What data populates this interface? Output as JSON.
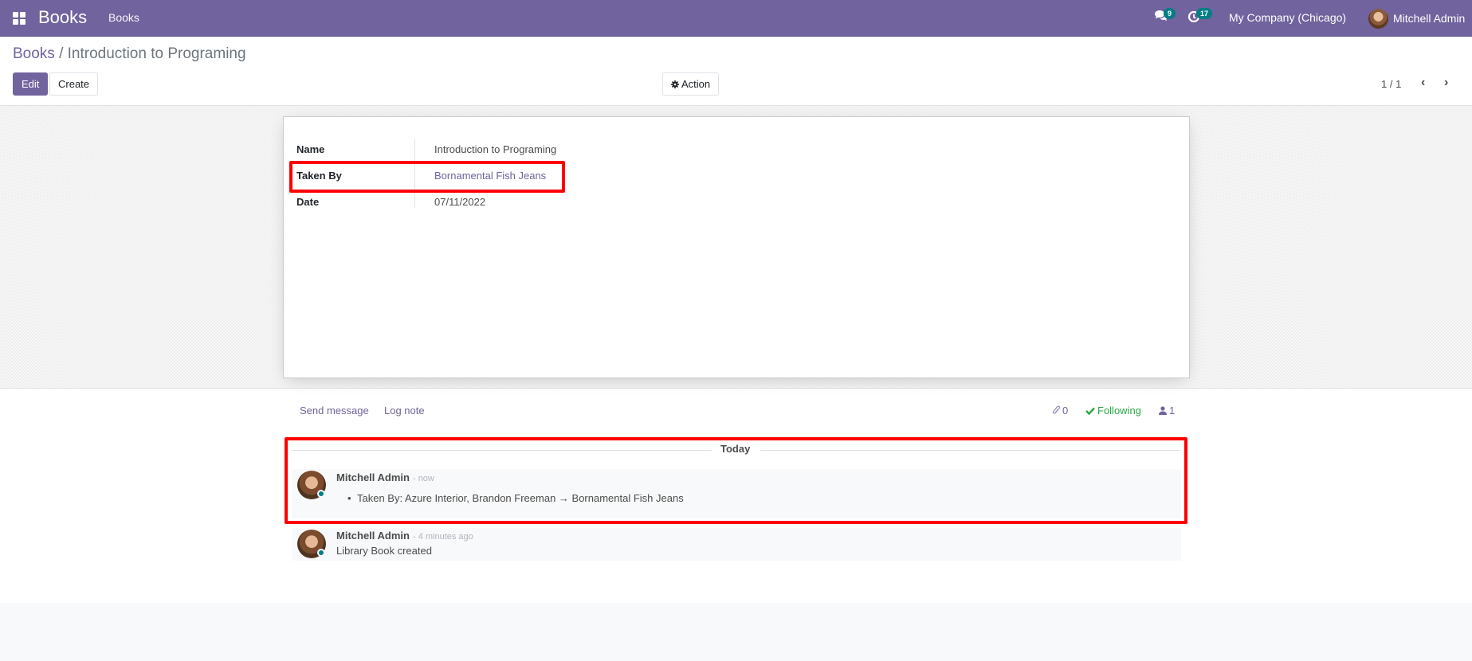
{
  "navbar": {
    "app_name": "Books",
    "menu_items": [
      "Books"
    ],
    "messages_count": "9",
    "activities_count": "17",
    "company": "My Company (Chicago)",
    "user_name": "Mitchell Admin"
  },
  "breadcrumb": {
    "parent": "Books",
    "separator": "/",
    "current": "Introduction to Programing"
  },
  "control_panel": {
    "edit_label": "Edit",
    "create_label": "Create",
    "action_label": "Action",
    "pager_value": "1 / 1"
  },
  "form": {
    "fields": [
      {
        "label": "Name",
        "value": "Introduction to Programing"
      },
      {
        "label": "Taken By",
        "value": "Bornamental Fish Jeans"
      },
      {
        "label": "Date",
        "value": "07/11/2022"
      }
    ]
  },
  "chatter": {
    "send_message_label": "Send message",
    "log_note_label": "Log note",
    "attachments_count": "0",
    "following_label": "Following",
    "followers_count": "1",
    "date_separator": "Today",
    "messages": [
      {
        "author": "Mitchell Admin",
        "date": "- now",
        "tracking": "Taken By: Azure Interior, Brandon Freeman → Bornamental Fish Jeans"
      },
      {
        "author": "Mitchell Admin",
        "date": "- 4 minutes ago",
        "body": "Library Book created"
      }
    ]
  },
  "colors": {
    "brand": "#71639e",
    "badge": "#017e84",
    "following": "#28a745",
    "highlight": "#ff0000"
  }
}
